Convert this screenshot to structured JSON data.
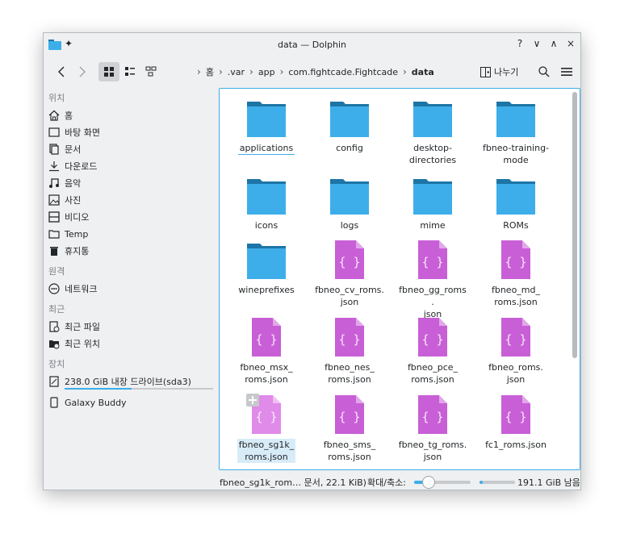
{
  "window": {
    "title": "data — Dolphin",
    "controls": {
      "help": "?",
      "minimize": "∨",
      "maximize": "∧",
      "close": "×"
    }
  },
  "toolbar": {
    "breadcrumb": [
      {
        "label": "홈"
      },
      {
        "label": ".var"
      },
      {
        "label": "app"
      },
      {
        "label": "com.fightcade.Fightcade"
      },
      {
        "label": "data"
      }
    ],
    "split_label": "나누기"
  },
  "sidebar": {
    "sections": [
      {
        "header": "위치",
        "items": [
          "홈",
          "바탕 화면",
          "문서",
          "다운로드",
          "음악",
          "사진",
          "비디오",
          "Temp",
          "휴지통"
        ]
      },
      {
        "header": "원격",
        "items": [
          "네트워크"
        ]
      },
      {
        "header": "최근",
        "items": [
          "최근 파일",
          "최근 위치"
        ]
      },
      {
        "header": "장치",
        "items": [
          "238.0 GiB 내장 드라이브(sda3)",
          "Galaxy Buddy"
        ]
      }
    ],
    "capacity_fraction": 0.45
  },
  "files": [
    {
      "name": "applications",
      "type": "folder"
    },
    {
      "name": "config",
      "type": "folder"
    },
    {
      "name": "desktop-directories",
      "type": "folder"
    },
    {
      "name": "fbneo-training-mode",
      "type": "folder"
    },
    {
      "name": "icons",
      "type": "folder"
    },
    {
      "name": "logs",
      "type": "folder"
    },
    {
      "name": "mime",
      "type": "folder"
    },
    {
      "name": "ROMs",
      "type": "folder"
    },
    {
      "name": "wineprefixes",
      "type": "folder"
    },
    {
      "name": "fbneo_cv_roms.json",
      "type": "json"
    },
    {
      "name": "fbneo_gg_roms.json",
      "type": "json"
    },
    {
      "name": "fbneo_md_roms.json",
      "type": "json"
    },
    {
      "name": "fbneo_msx_roms.json",
      "type": "json"
    },
    {
      "name": "fbneo_nes_roms.json",
      "type": "json"
    },
    {
      "name": "fbneo_pce_roms.json",
      "type": "json"
    },
    {
      "name": "fbneo_roms.json",
      "type": "json"
    },
    {
      "name": "fbneo_sg1k_roms.json",
      "type": "json"
    },
    {
      "name": "fbneo_sms_roms.json",
      "type": "json"
    },
    {
      "name": "fbneo_tg_roms.json",
      "type": "json"
    },
    {
      "name": "fc1_roms.json",
      "type": "json"
    }
  ],
  "status": {
    "selection_text": "fbneo_sg1k_rom… 문서, 22.1 KiB)",
    "zoom_label": "확대/축소:",
    "zoom_fraction": 0.25,
    "free_space_text": "191.1 GiB 남음",
    "free_fraction": 0.1
  },
  "colors": {
    "accent": "#3daee9",
    "folder_top": "#1d75a6",
    "folder_body": "#3daee9",
    "json_icon": "#c85fd6",
    "json_icon_light": "#e08ae9"
  }
}
